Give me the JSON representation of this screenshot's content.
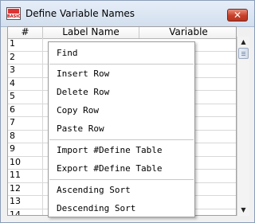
{
  "window": {
    "title": "Define Variable Names",
    "icon_text": "BASIC",
    "close_label": "✕"
  },
  "table": {
    "headers": [
      "#",
      "Label Name",
      "Variable"
    ],
    "row_numbers": [
      "1",
      "2",
      "3",
      "4",
      "5",
      "6",
      "7",
      "8",
      "9",
      "10",
      "11",
      "12",
      "13",
      "14"
    ]
  },
  "context_menu": {
    "find": "Find",
    "insert_row": "Insert Row",
    "delete_row": "Delete Row",
    "copy_row": "Copy Row",
    "paste_row": "Paste Row",
    "import_define": "Import #Define Table",
    "export_define": "Export #Define Table",
    "ascending_sort": "Ascending Sort",
    "descending_sort": "Descending Sort"
  },
  "scrollbar": {
    "up_arrow": "▲",
    "down_arrow": "▼"
  }
}
